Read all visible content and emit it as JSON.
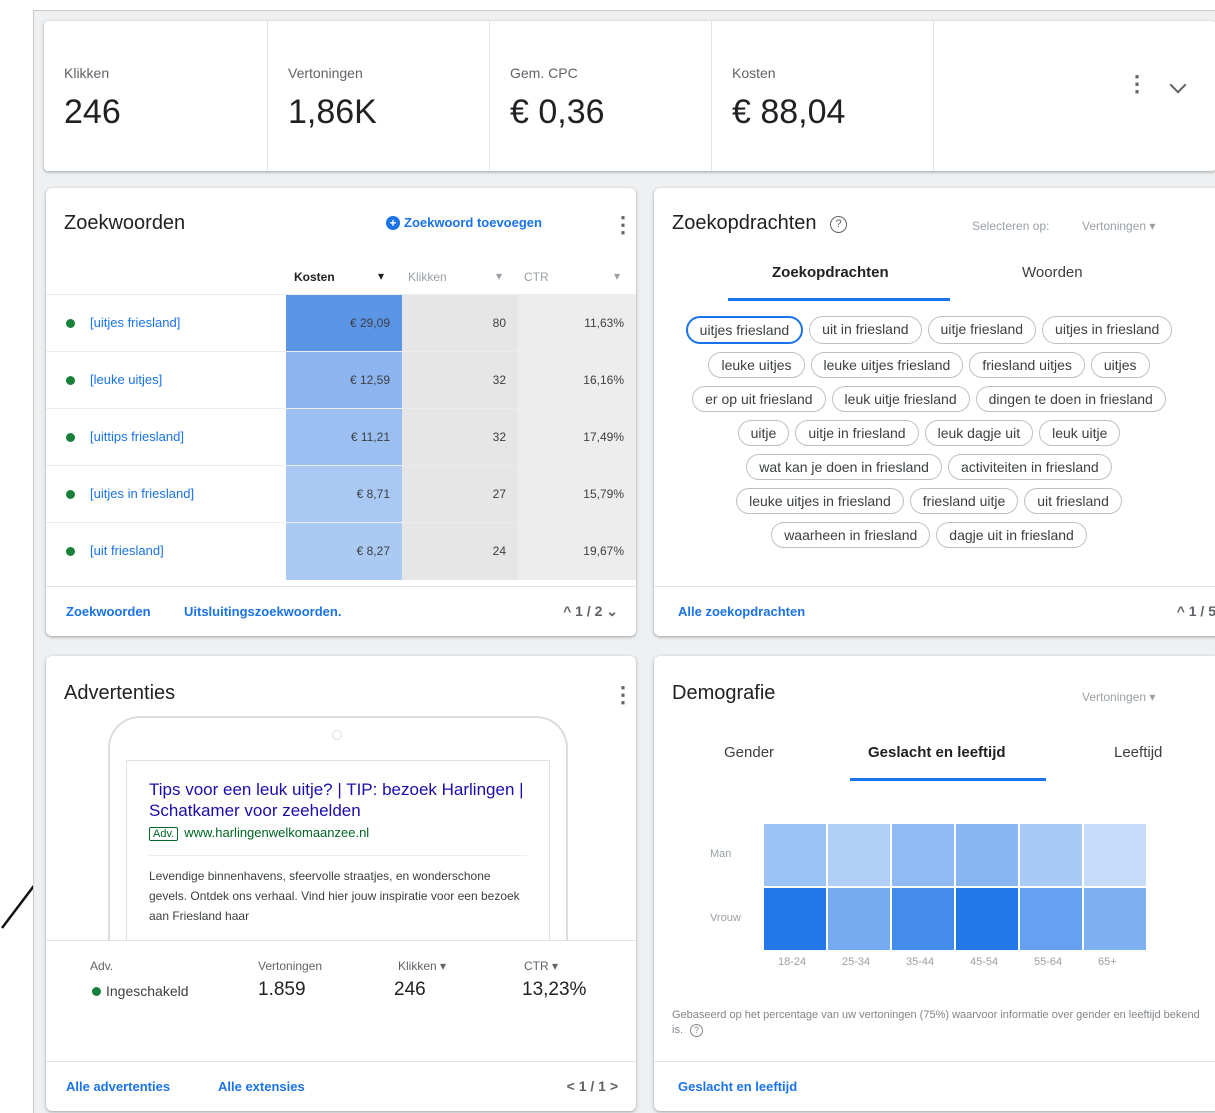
{
  "metrics": [
    {
      "label": "Klikken",
      "value": "246"
    },
    {
      "label": "Vertoningen",
      "value": "1,86K"
    },
    {
      "label": "Gem. CPC",
      "value": "€ 0,36"
    },
    {
      "label": "Kosten",
      "value": "€ 88,04"
    }
  ],
  "icons": {
    "more": "⋮",
    "expand": "⌄",
    "add": "+",
    "help": "?",
    "sort_desc": "▾",
    "dropdown": "▾",
    "arrow": "arrow-pointer"
  },
  "keywords": {
    "title": "Zoekwoorden",
    "add_label": "Zoekwoord toevoegen",
    "columns": [
      "Kosten",
      "Klikken",
      "CTR"
    ],
    "rows": [
      {
        "name": "[uitjes friesland]",
        "cost": "€ 29,09",
        "clicks": "80",
        "ctr": "11,63%"
      },
      {
        "name": "[leuke uitjes]",
        "cost": "€ 12,59",
        "clicks": "32",
        "ctr": "16,16%"
      },
      {
        "name": "[uittips friesland]",
        "cost": "€ 11,21",
        "clicks": "32",
        "ctr": "17,49%"
      },
      {
        "name": "[uitjes in friesland]",
        "cost": "€ 8,71",
        "clicks": "27",
        "ctr": "15,79%"
      },
      {
        "name": "[uit friesland]",
        "cost": "€ 8,27",
        "clicks": "24",
        "ctr": "19,67%"
      }
    ],
    "footer_links": [
      "Zoekwoorden",
      "Uitsluitingszoekwoorden."
    ],
    "pager": "^ 1 / 2 ⌄",
    "status_color": "#188038"
  },
  "queries": {
    "title": "Zoekopdrachten",
    "select_label": "Selecteren op:",
    "select_value": "Vertoningen",
    "tabs": [
      "Zoekopdrachten",
      "Woorden"
    ],
    "chips": [
      "uitjes friesland",
      "uit in friesland",
      "uitje friesland",
      "uitjes in friesland",
      "leuke uitjes",
      "leuke uitjes friesland",
      "friesland uitjes",
      "uitjes",
      "er op uit friesland",
      "leuk uitje friesland",
      "dingen te doen in friesland",
      "uitje",
      "uitje in friesland",
      "leuk dagje uit",
      "leuk uitje",
      "wat kan je doen in friesland",
      "activiteiten in friesland",
      "leuke uitjes in friesland",
      "friesland uitje",
      "uit friesland",
      "waarheen in friesland",
      "dagje uit in friesland"
    ],
    "footer_link": "Alle zoekopdrachten",
    "pager": "^ 1 / 5"
  },
  "ads": {
    "title": "Advertenties",
    "headline": "Tips voor een leuk uitje? | TIP: bezoek Harlingen | Schatkamer voor zeehelden",
    "badge": "Adv.",
    "url": "www.harlingenwelkomaanzee.nl",
    "description": "Levendige binnenhavens, sfeervolle straatjes, en wonderschone gevels. Ontdek ons verhaal. Vind hier jouw inspiratie voor een bezoek aan Friesland haar",
    "stat_labels": [
      "Adv.",
      "Vertoningen",
      "Klikken",
      "CTR"
    ],
    "status": "Ingeschakeld",
    "impressions": "1.859",
    "clicks": "246",
    "ctr": "13,23%",
    "footer_links": [
      "Alle advertenties",
      "Alle extensies"
    ],
    "pager": "< 1 / 1 >"
  },
  "demographics": {
    "title": "Demografie",
    "select_value": "Vertoningen",
    "tabs": [
      "Gender",
      "Geslacht en leeftijd",
      "Leeftijd"
    ],
    "rows": [
      "Man",
      "Vrouw"
    ],
    "age_groups": [
      "18-24",
      "25-34",
      "35-44",
      "45-54",
      "55-64",
      "65+"
    ],
    "heat_intensity": {
      "Man": [
        0.35,
        0.25,
        0.42,
        0.45,
        0.3,
        0.15
      ],
      "Vrouw": [
        0.95,
        0.55,
        0.8,
        0.95,
        0.62,
        0.5
      ]
    },
    "note": "Gebaseerd op het percentage van uw vertoningen (75%) waarvoor informatie over gender en leeftijd bekend is.",
    "footer_link": "Geslacht en leeftijd",
    "accent": "#1a73e8"
  }
}
